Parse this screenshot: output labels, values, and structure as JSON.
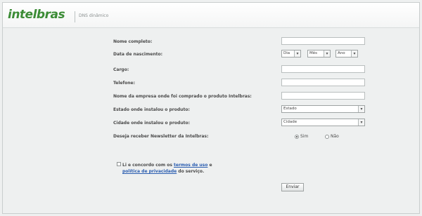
{
  "header": {
    "logo_text": "intelbras",
    "subtitle": "DNS dinâmico"
  },
  "form": {
    "full_name_label": "Nome completo:",
    "birth_date_label": "Data de nascimento:",
    "day_value": "Dia",
    "month_value": "Mês",
    "year_value": "Ano",
    "role_label": "Cargo:",
    "phone_label": "Telefone:",
    "store_label": "Nome da empresa onde foi comprado o produto Intelbras:",
    "state_label": "Estado onde instalou o produto:",
    "state_value": "Estado",
    "city_label": "Cidade onde instalou o produto:",
    "city_value": "Cidade",
    "newsletter_label": "Deseja receber Newsletter da Intelbras:",
    "newsletter_yes": "Sim",
    "newsletter_no": "Não",
    "newsletter_selected": "Sim"
  },
  "terms": {
    "prefix": "Li e concordo com os ",
    "terms_link": "termos de uso",
    "and": " e",
    "privacy_link": "política de privacidade",
    "suffix": " do serviço."
  },
  "submit_label": "Enviar"
}
